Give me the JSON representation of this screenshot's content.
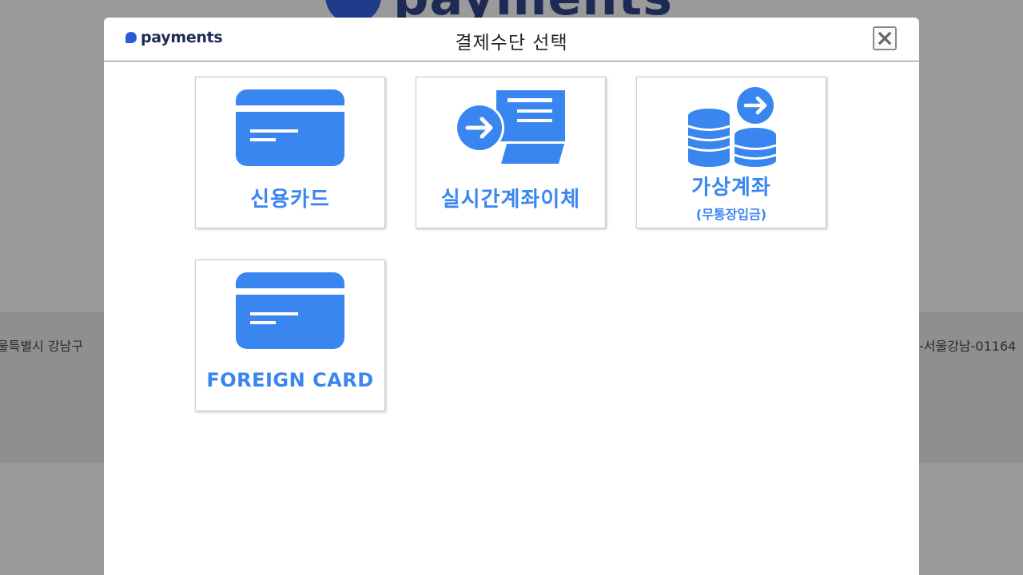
{
  "background": {
    "logo_text": "payments",
    "footer_left": "울특별시 강남구",
    "footer_right": "-서울강남-01164"
  },
  "modal": {
    "brand_text": "payments",
    "title": "결제수단 선택",
    "close_icon": "close-icon"
  },
  "options": [
    {
      "label": "신용카드",
      "icon": "credit-card-icon"
    },
    {
      "label": "실시간계좌이체",
      "icon": "bank-transfer-icon"
    },
    {
      "label": "가상계좌",
      "sublabel": "(무통장입금)",
      "icon": "coins-icon"
    },
    {
      "label": "FOREIGN CARD",
      "icon": "credit-card-icon"
    }
  ],
  "colors": {
    "accent": "#3a86f0",
    "brand": "#1c2a55",
    "overlay": "#9a9a9a"
  }
}
